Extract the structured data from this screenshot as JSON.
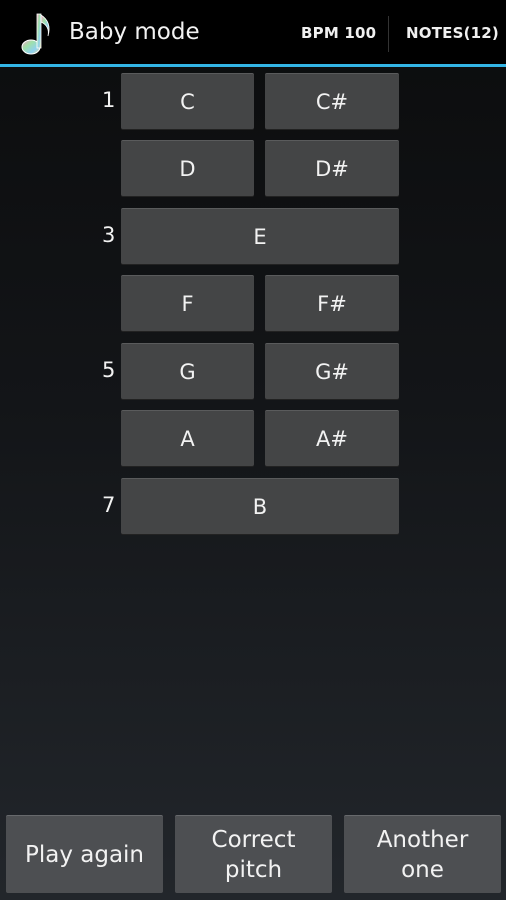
{
  "actionbar": {
    "app_icon": "music-note-icon",
    "title": "Baby mode",
    "bpm_label": "BPM 100",
    "notes_label": "NOTES(12)",
    "accent_color": "#33b5e5"
  },
  "keys": {
    "c": "C",
    "c_sharp": "C#",
    "d": "D",
    "d_sharp": "D#",
    "e": "E",
    "f": "F",
    "f_sharp": "F#",
    "g": "G",
    "g_sharp": "G#",
    "a": "A",
    "a_sharp": "A#",
    "b": "B"
  },
  "row_numbers": {
    "r1": "1",
    "r3": "3",
    "r5": "5",
    "r7": "7"
  },
  "bottom": {
    "play_again": "Play again",
    "correct_pitch_line1": "Correct",
    "correct_pitch_line2": "pitch",
    "another_one_line1": "Another",
    "another_one_line2": "one"
  }
}
